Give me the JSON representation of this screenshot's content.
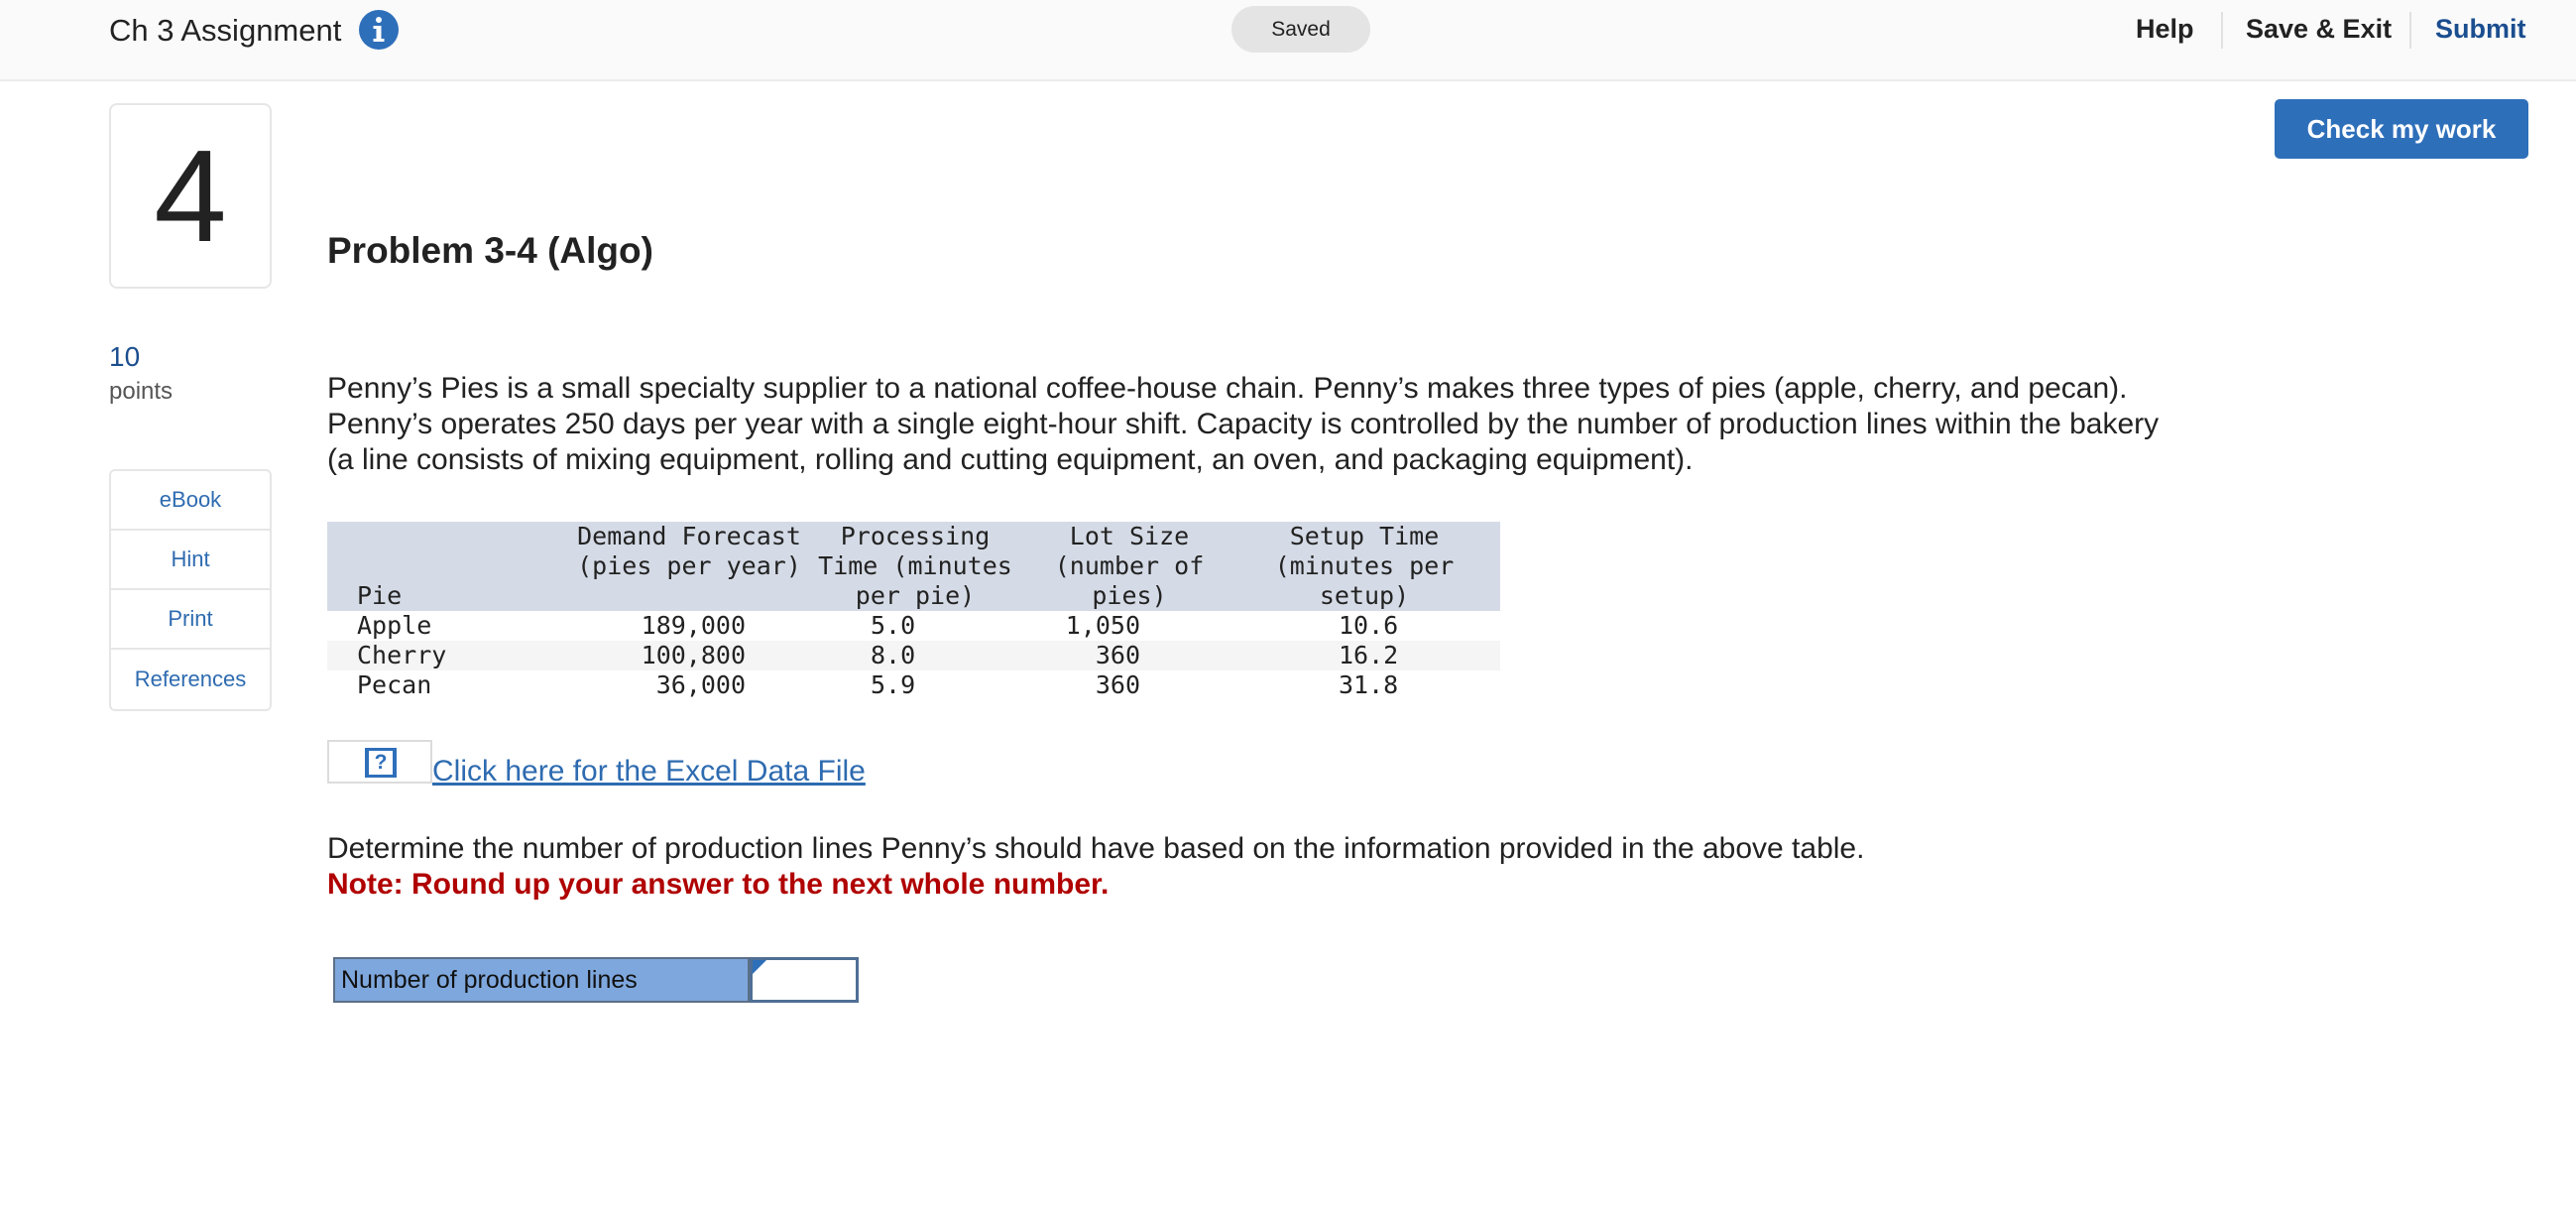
{
  "header": {
    "assignment_title": "Ch 3 Assignment",
    "saved_status": "Saved",
    "help_label": "Help",
    "save_exit_label": "Save & Exit",
    "submit_label": "Submit"
  },
  "question": {
    "number": "4",
    "points_value": "10",
    "points_label": "points",
    "check_label": "Check my work",
    "title": "Problem 3-4 (Algo)",
    "intro": "Penny’s Pies is a small specialty supplier to a national coffee-house chain. Penny’s makes three types of pies (apple, cherry, and pecan). Penny’s operates 250 days per year with a single eight-hour shift. Capacity is controlled by the number of production lines within the bakery (a line consists of mixing equipment, rolling and cutting equipment, an oven, and packaging equipment).",
    "excel_link": "Click here for the Excel Data File",
    "prompt": "Determine the number of production lines Penny’s should have based on the information provided in the above table.",
    "note": "Note: Round up your answer to the next whole number."
  },
  "resources": {
    "items": [
      {
        "label": "eBook"
      },
      {
        "label": "Hint"
      },
      {
        "label": "Print"
      },
      {
        "label": "References"
      }
    ]
  },
  "table": {
    "headers": {
      "pie": "Pie",
      "demand": "Demand Forecast\n(pies per year)",
      "processing": "Processing\nTime (minutes\nper pie)",
      "lot": "Lot Size\n(number of\npies)",
      "setup": "Setup Time\n(minutes per\nsetup)"
    },
    "rows": [
      {
        "pie": "Apple",
        "demand": "189,000",
        "processing": "5.0",
        "lot": "1,050",
        "setup": "10.6"
      },
      {
        "pie": "Cherry",
        "demand": "100,800",
        "processing": "8.0",
        "lot": "360",
        "setup": "16.2"
      },
      {
        "pie": "Pecan",
        "demand": "36,000",
        "processing": "5.9",
        "lot": "360",
        "setup": "31.8"
      }
    ]
  },
  "answer": {
    "label": "Number of production lines",
    "value": ""
  },
  "colors": {
    "brand_blue": "#2e6fba",
    "note_red": "#b00000",
    "answer_label_bg": "#7ea7dd",
    "table_header_bg": "#d5dbe6"
  },
  "icons": {
    "info": "info-circle-icon",
    "excel_help": "question-mark-icon"
  }
}
